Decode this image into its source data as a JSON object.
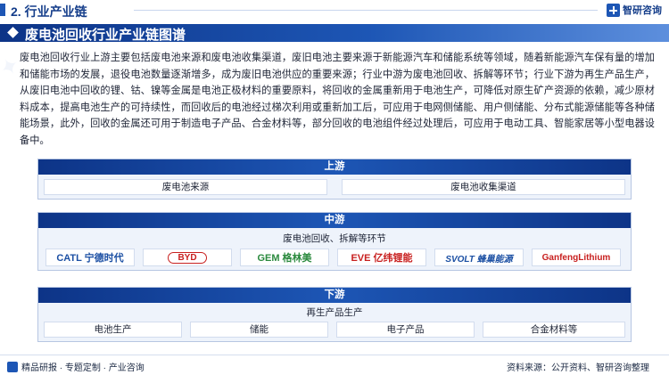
{
  "header": {
    "section_title": "2. 行业产业链",
    "brand": "智研咨询"
  },
  "banner": {
    "title": "废电池回收行业产业链图谱"
  },
  "intro": "废电池回收行业上游主要包括废电池来源和废电池收集渠道，废旧电池主要来源于新能源汽车和储能系统等领域，随着新能源汽车保有量的增加和储能市场的发展，退役电池数量逐渐增多，成为废旧电池供应的重要来源；行业中游为废电池回收、拆解等环节；行业下游为再生产品生产，从废旧电池中回收的锂、钴、镍等金属是电池正极材料的重要原料，将回收的金属重新用于电池生产，可降低对原生矿产资源的依赖，减少原材料成本，提高电池生产的可持续性，而回收后的电池经过梯次利用或重新加工后，可应用于电网侧储能、用户侧储能、分布式能源储能等各种储能场景，此外，回收的金属还可用于制造电子产品、合金材料等，部分回收的电池组件经过处理后，可应用于电动工具、智能家居等小型电器设备中。",
  "upstream": {
    "title": "上游",
    "items": [
      "废电池来源",
      "废电池收集渠道"
    ]
  },
  "midstream": {
    "title": "中游",
    "subtitle": "废电池回收、拆解等环节",
    "logos": [
      {
        "text": "CATL 宁德时代",
        "color": "#1b4fa3"
      },
      {
        "text": "BYD",
        "color": "#c8201f"
      },
      {
        "text": "GEM 格林美",
        "color": "#2b8a3e"
      },
      {
        "text": "EVE 亿纬锂能",
        "color": "#c8201f"
      },
      {
        "text": "SVOLT 蜂巢能源",
        "color": "#1b4fa3"
      },
      {
        "text": "GanfengLithium",
        "color": "#c8201f"
      }
    ]
  },
  "downstream": {
    "title": "下游",
    "subtitle": "再生产品生产",
    "items": [
      "电池生产",
      "储能",
      "电子产品",
      "合金材料等"
    ]
  },
  "footer": {
    "left": "精品研报 · 专题定制 · 产业咨询",
    "right": "资料来源：公开资料、智研咨询整理"
  },
  "colors": {
    "primary": "#1d56b5",
    "dark": "#0d3487"
  }
}
